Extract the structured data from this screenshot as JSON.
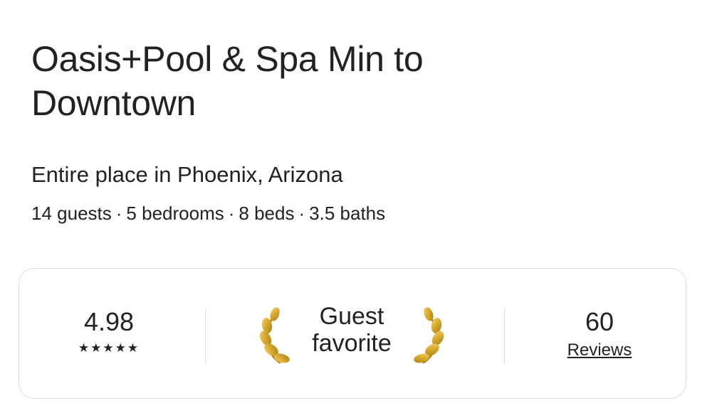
{
  "listing": {
    "title": "Oasis+Pool & Spa Min to Downtown",
    "subtitle": "Entire place in Phoenix, Arizona",
    "details": [
      "14 guests",
      "5 bedrooms",
      "8 beds",
      "3.5 baths"
    ],
    "separator": "·"
  },
  "highlights": {
    "rating": {
      "value": "4.98",
      "stars": "★★★★★",
      "star_count": 5
    },
    "badge": {
      "line1": "Guest",
      "line2": "favorite",
      "icon": "laurel-icon",
      "laurel_color": "#d4a72c"
    },
    "reviews": {
      "count": "60",
      "label": "Reviews"
    }
  },
  "colors": {
    "text": "#222222",
    "border": "#dddddd"
  }
}
